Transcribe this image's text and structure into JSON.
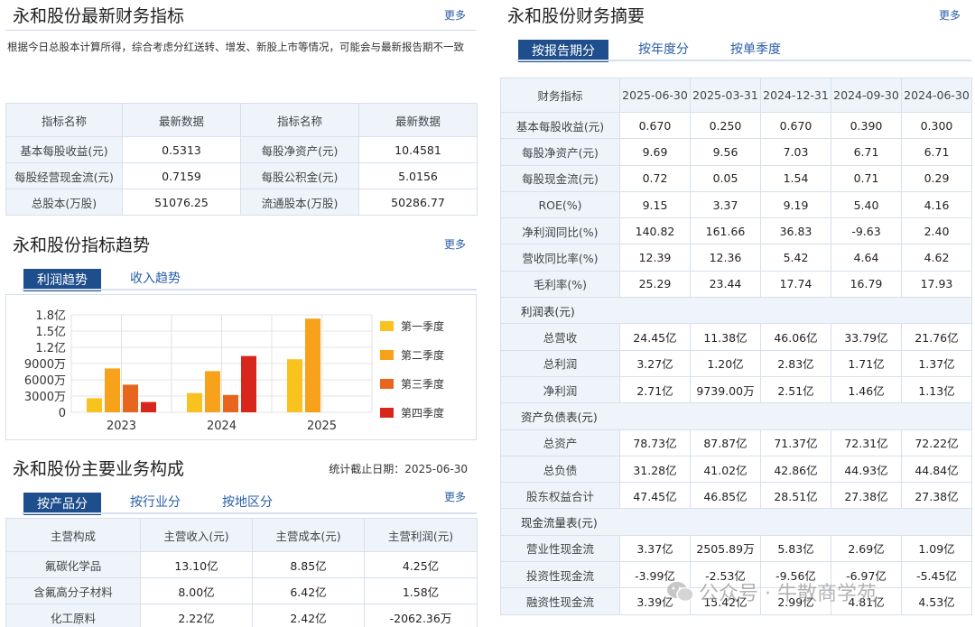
{
  "left_top": {
    "title": "永和股份最新财务指标",
    "more": "更多",
    "note": "根据今日总股本计算所得，综合考虑分红送转、增发、新股上市等情况，可能会与最新报告期不一致",
    "headers": [
      "指标名称",
      "最新数据",
      "指标名称",
      "最新数据"
    ],
    "rows": [
      [
        "基本每股收益(元)",
        "0.5313",
        "每股净资产(元)",
        "10.4581"
      ],
      [
        "每股经营现金流(元)",
        "0.7159",
        "每股公积金(元)",
        "5.0156"
      ],
      [
        "总股本(万股)",
        "51076.25",
        "流通股本(万股)",
        "50286.77"
      ]
    ]
  },
  "trend": {
    "title": "永和股份指标趋势",
    "more": "更多",
    "tabs": [
      "利润趋势",
      "收入趋势"
    ]
  },
  "chart_data": {
    "type": "bar",
    "categories": [
      "2023",
      "2024",
      "2025"
    ],
    "series": [
      {
        "name": "第一季度",
        "color": "#f9c21f",
        "values": [
          26000000,
          35500000,
          98000000
        ]
      },
      {
        "name": "第二季度",
        "color": "#f7a21a",
        "values": [
          81000000,
          76000000,
          173000000
        ]
      },
      {
        "name": "第三季度",
        "color": "#e8651e",
        "values": [
          51000000,
          32000000,
          null
        ]
      },
      {
        "name": "第四季度",
        "color": "#d9261c",
        "values": [
          19000000,
          104000000,
          null
        ]
      }
    ],
    "ytick_labels": [
      "0",
      "3000万",
      "6000万",
      "9000万",
      "1.2亿",
      "1.5亿",
      "1.8亿"
    ],
    "ylim": [
      0,
      180000000
    ]
  },
  "business": {
    "title": "永和股份主要业务构成",
    "date_label": "统计截止日期：2025-06-30",
    "tabs": [
      "按产品分",
      "按行业分",
      "按地区分"
    ],
    "more": "更多",
    "headers": [
      "主营构成",
      "主营收入(元)",
      "主营成本(元)",
      "主营利润(元)"
    ],
    "rows": [
      [
        "氟碳化学品",
        "13.10亿",
        "8.85亿",
        "4.25亿"
      ],
      [
        "含氟高分子材料",
        "8.00亿",
        "6.42亿",
        "1.58亿"
      ],
      [
        "化工原料",
        "2.22亿",
        "2.42亿",
        "-2062.36万"
      ]
    ]
  },
  "summary": {
    "title": "永和股份财务摘要",
    "more": "更多",
    "tabs": [
      "按报告期分",
      "按年度分",
      "按单季度"
    ],
    "headers": [
      "财务指标",
      "2025-06-30",
      "2025-03-31",
      "2024-12-31",
      "2024-09-30",
      "2024-06-30"
    ],
    "rows": [
      {
        "label": "基本每股收益(元)",
        "values": [
          "0.670",
          "0.250",
          "0.670",
          "0.390",
          "0.300"
        ]
      },
      {
        "label": "每股净资产(元)",
        "values": [
          "9.69",
          "9.56",
          "7.03",
          "6.71",
          "6.71"
        ]
      },
      {
        "label": "每股现金流(元)",
        "values": [
          "0.72",
          "0.05",
          "1.54",
          "0.71",
          "0.29"
        ]
      },
      {
        "label": "ROE(%)",
        "values": [
          "9.15",
          "3.37",
          "9.19",
          "5.40",
          "4.16"
        ]
      },
      {
        "label": "净利润同比(%)",
        "values": [
          "140.82",
          "161.66",
          "36.83",
          "-9.63",
          "2.40"
        ]
      },
      {
        "label": "营收同比率(%)",
        "values": [
          "12.39",
          "12.36",
          "5.42",
          "4.64",
          "4.62"
        ]
      },
      {
        "label": "毛利率(%)",
        "values": [
          "25.29",
          "23.44",
          "17.74",
          "16.79",
          "17.93"
        ]
      },
      {
        "group": "利润表(元)"
      },
      {
        "label": "总营收",
        "values": [
          "24.45亿",
          "11.38亿",
          "46.06亿",
          "33.79亿",
          "21.76亿"
        ]
      },
      {
        "label": "总利润",
        "values": [
          "3.27亿",
          "1.20亿",
          "2.83亿",
          "1.71亿",
          "1.37亿"
        ]
      },
      {
        "label": "净利润",
        "values": [
          "2.71亿",
          "9739.00万",
          "2.51亿",
          "1.46亿",
          "1.13亿"
        ]
      },
      {
        "group": "资产负债表(元)"
      },
      {
        "label": "总资产",
        "values": [
          "78.73亿",
          "87.87亿",
          "71.37亿",
          "72.31亿",
          "72.22亿"
        ]
      },
      {
        "label": "总负债",
        "values": [
          "31.28亿",
          "41.02亿",
          "42.86亿",
          "44.93亿",
          "44.84亿"
        ]
      },
      {
        "label": "股东权益合计",
        "values": [
          "47.45亿",
          "46.85亿",
          "28.51亿",
          "27.38亿",
          "27.38亿"
        ]
      },
      {
        "group": "现金流量表(元)"
      },
      {
        "label": "营业性现金流",
        "values": [
          "3.37亿",
          "2505.89万",
          "5.83亿",
          "2.69亿",
          "1.09亿"
        ]
      },
      {
        "label": "投资性现金流",
        "values": [
          "-3.99亿",
          "-2.53亿",
          "-9.56亿",
          "-6.97亿",
          "-5.45亿"
        ]
      },
      {
        "label": "融资性现金流",
        "values": [
          "3.39亿",
          "15.42亿",
          "2.99亿",
          "4.81亿",
          "4.53亿"
        ]
      }
    ]
  },
  "watermark": {
    "text": "公众号 · 牛散商学苑",
    "icon": "wechat-icon"
  }
}
